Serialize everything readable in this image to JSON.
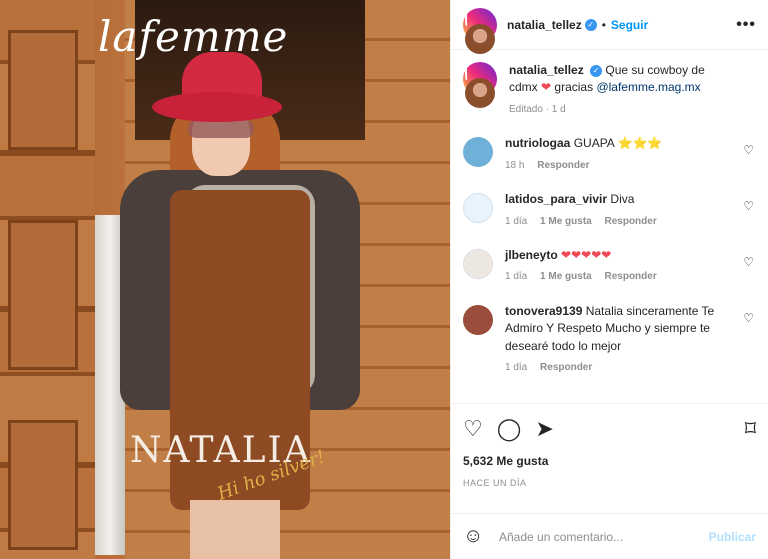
{
  "post": {
    "image_alt": "Portada lafemme con Natalia Téllez",
    "cover_logo": "lafemme",
    "cover_name": "NATALIA",
    "cover_subtitle": "Hi ho silver!"
  },
  "header": {
    "username": "natalia_tellez",
    "follow_label": "Seguir",
    "more_icon": "more-icon"
  },
  "caption": {
    "username": "natalia_tellez",
    "text_before": "Que su cowboy de cdmx",
    "text_after": "gracias",
    "mention": "@lafemme.mag.mx",
    "meta": "Editado · 1 d"
  },
  "comments": [
    {
      "username": "nutriologaa",
      "text": "GUAPA",
      "time": "18 h",
      "likes": "",
      "reply": "Responder",
      "avatar_color": "#6fb0d8"
    },
    {
      "username": "latidos_para_vivir",
      "text": "Diva",
      "time": "1 día",
      "likes": "1 Me gusta",
      "reply": "Responder",
      "avatar_color": "#7bb6e8"
    },
    {
      "username": "jlbeneyto",
      "text": "",
      "time": "1 día",
      "likes": "1 Me gusta",
      "reply": "Responder",
      "avatar_color": "#e8e0d8"
    },
    {
      "username": "tonovera9139",
      "text": "Natalia sinceramente Te Admiro Y Respeto Mucho y siempre te desearé todo lo mejor",
      "time": "1 día",
      "likes": "",
      "reply": "Responder",
      "avatar_color": "#9b4d3c"
    }
  ],
  "actions": {
    "likes": "5,632 Me gusta",
    "time": "HACE UN DÍA"
  },
  "add_comment": {
    "placeholder": "Añade un comentario...",
    "publish_label": "Publicar"
  }
}
